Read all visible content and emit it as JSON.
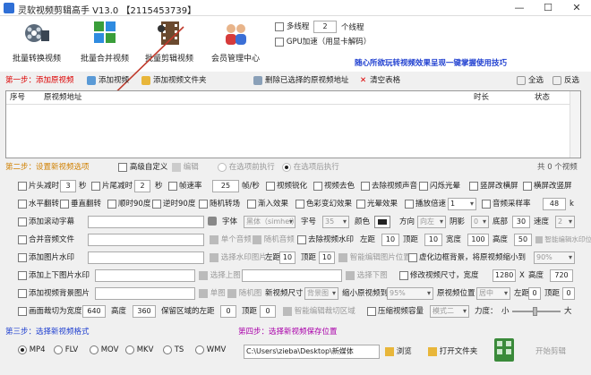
{
  "title": "灵软视频剪辑高手 V13.0 【2115453739】",
  "window_buttons": {
    "minimize": "—",
    "maximize": "☐",
    "close": "✕"
  },
  "toolbar": {
    "tools": [
      {
        "label": "批量转换视频",
        "icon": "film-reel-icon"
      },
      {
        "label": "批量合并视频",
        "icon": "merge-grid-icon"
      },
      {
        "label": "批量剪辑视频",
        "icon": "film-strip-icon"
      },
      {
        "label": "会员管理中心",
        "icon": "members-icon"
      }
    ],
    "multithread_label": "多线程",
    "thread_count": "2",
    "thread_unit": "个线程",
    "gpu_label": "GPU加速（用显卡解码）",
    "slogan": "随心所欲玩转视频效果呈现一键掌握使用技巧"
  },
  "step1": {
    "title": "第一步：添加原视频",
    "add_video": "添加视频",
    "add_folder": "添加视频文件夹",
    "delete_selected": "删除已选择的原视频地址",
    "clear_table": "清空表格",
    "select_all": "全选",
    "invert": "反选",
    "columns": [
      "序号",
      "原视频地址",
      "时长",
      "状态"
    ]
  },
  "step2": {
    "title": "第二步：设置新视频选项",
    "advanced": "高级自定义",
    "edit": "编辑",
    "before_exec": "在选项前执行",
    "after_exec": "在选项后执行",
    "count": "共 0 个视频",
    "row1": {
      "head_cut": "片头减时",
      "head_val": "3",
      "sec1": "秒",
      "tail_cut": "片尾减时",
      "tail_val": "2",
      "sec2": "秒",
      "framerate_label": "帧速率",
      "framerate_val": "25",
      "fps_unit": "帧/秒",
      "sharpen": "视频锐化",
      "decolor": "视频去色",
      "remove_audio": "去除视频声音",
      "flash": "闪烁光晕",
      "vertical_split": "竖屏改横屏",
      "landscape_to_portrait": "横屏改竖屏"
    },
    "row2": {
      "hflip": "水平翻转",
      "vflip": "垂直翻转",
      "rot90cw": "顺时90度",
      "rot90ccw": "逆时90度",
      "random_trans": "随机转场",
      "fade": "渐入效果",
      "color_change": "色彩变幻效果",
      "light": "光晕效果",
      "speed_label": "播放倍速",
      "speed_val": "1",
      "samplerate_label": "音频采样率",
      "samplerate_val": "48",
      "k": "k"
    },
    "row3": {
      "label": "添加滚动字幕",
      "font_label": "字体",
      "font_val": "黑体（simhei）",
      "size_label": "字号",
      "size_val": "35",
      "color_label": "颜色",
      "dir_label": "方向",
      "dir_val": "向左",
      "shadow_label": "阴影",
      "shadow_val": "0",
      "bottom_label": "底部",
      "bottom_val": "30",
      "speed_label": "速度",
      "speed_val": "2"
    },
    "row4": {
      "label": "合并音频文件",
      "single_audio": "单个音频",
      "random_audio": "随机音频",
      "remove_wm": "去除视频水印",
      "left_label": "左距",
      "left_val": "10",
      "top_label": "顶距",
      "top_val": "10",
      "width_label": "宽度",
      "width_val": "100",
      "height_label": "高度",
      "height_val": "50",
      "smart_wm": "智能编辑水印位置"
    },
    "row5": {
      "label": "添加图片水印",
      "choose_img": "选择水印图片",
      "left_label": "左距",
      "left_val": "10",
      "top_label": "顶距",
      "top_val": "10",
      "smart_img": "智能编辑图片位置",
      "blur_bg": "虚化边框背景，将原视频缩小到",
      "blur_val": "90%"
    },
    "row6": {
      "label": "添加上下图片水印",
      "choose_top": "选择上图",
      "choose_bottom": "选择下图",
      "modify_size": "修改视频尺寸，宽度",
      "w_val": "1280",
      "x": "X",
      "h_label": "高度",
      "h_val": "720"
    },
    "row7": {
      "label": "添加视频背景图片",
      "single": "单图",
      "random": "随机图",
      "new_size": "新视频尺寸",
      "new_size_val": "背景图",
      "shrink_label": "缩小原视频到",
      "shrink_val": "95%",
      "pos_label": "原视频位置",
      "pos_val": "居中",
      "left_label": "左距",
      "left_val": "0",
      "top_label": "顶距",
      "top_val": "0"
    },
    "row8": {
      "label": "画面裁切为宽度",
      "w_val": "640",
      "h_label": "高度",
      "h_val": "360",
      "keep_label": "保留区域的左距",
      "keep_left": "0",
      "top_label": "顶距",
      "top_val": "0",
      "smart_crop": "智能编辑裁切区域",
      "compress": "压缩视频容量",
      "mode_val": "模式二",
      "strength_label": "力度：",
      "small": "小",
      "big": "大"
    }
  },
  "step3": {
    "title": "第三步：选择新视频格式",
    "formats": [
      "MP4",
      "FLV",
      "MOV",
      "MKV",
      "TS",
      "WMV"
    ],
    "selected": "MP4"
  },
  "step4": {
    "title": "第四步：选择新视频保存位置",
    "path": "C:\\Users\\zieba\\Desktop\\新媒体",
    "browse": "浏览",
    "open_folder": "打开文件夹",
    "start": "开始剪辑"
  },
  "colors": {
    "step_title": "#d00000",
    "step4_title": "#b000b0",
    "blue_text": "#1f3fd0",
    "slogan": "#1f3fd0",
    "arrow": "#c0392b"
  }
}
